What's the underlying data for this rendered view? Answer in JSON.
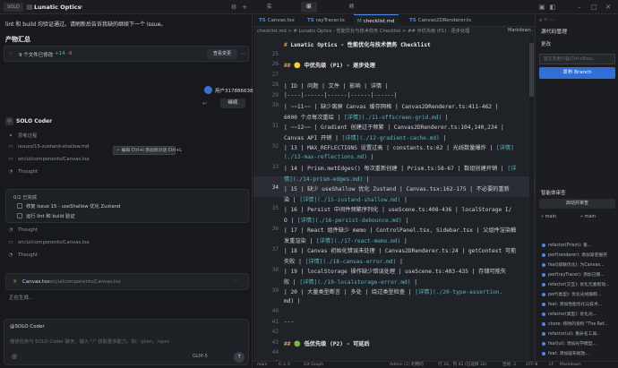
{
  "topbar": {
    "logo": "SOLO",
    "title": "Lunatic Optics",
    "tabs": [
      "实时跟踪",
      "编辑器",
      "终端"
    ],
    "active_tab": "编辑器"
  },
  "chat": {
    "message": "lint 和 build 均验证通过。请刷新后告诉我缺的继续下一个 Issue。",
    "products_heading": "产物汇总",
    "files_label": "9 个文件已修改",
    "files_added": "+14",
    "files_removed": "-9",
    "view_changes": "查看变更",
    "user_id": "用户3178866385",
    "continue_label": "继续",
    "agent_name": "SOLO Coder",
    "steps": [
      "思考过程",
      "issues/15-zustand-shallow.md",
      "src/ui/components/Canvas.tsx",
      "Thought"
    ],
    "todo_title": "0/2 已完成",
    "todos": [
      "修复 Issue 15 - useShallow 优化 Zustand",
      "运行 lint 和 build 验证"
    ],
    "steps2": [
      "Thought",
      "src/ui/components/Canvas.tsx",
      "Thought"
    ],
    "edit_file": "Canvas.tsx",
    "edit_path": "src/ui/components/Canvas.tsx",
    "generating": "正在生成...",
    "input_tag": "@SOLO Coder",
    "input_placeholder": "描述任务与 SOLO Coder 聊天，输入 \"/\" 获取更多能力。如：/plan、/spec",
    "model": "GLM-5"
  },
  "editor": {
    "tabs": [
      {
        "prefix": "TS",
        "name": "Canvas.tsx"
      },
      {
        "prefix": "TS",
        "name": "rayTracer.ts"
      },
      {
        "prefix": "M",
        "name": "checklist.md",
        "active": true
      },
      {
        "prefix": "TS",
        "name": "Canvas2DRenderer.ts"
      }
    ],
    "breadcrumb": "checklist.md > # Lunatic Optics - 性能优化与技术债务 Checklist > ## 中优先级 (P1) - 逐步处理",
    "markdown_btn": "Markdown",
    "hover_tip": "✓ 编辑 Ctrl+I 添加到对话 Ctrl+L",
    "lines": [
      {
        "n": "",
        "t": "# Lunatic Optics - 性能优化与技术债务 Checklist",
        "h": true
      },
      {
        "n": "25",
        "t": ""
      },
      {
        "n": "26",
        "t": "## 🟡 中优先级 (P1) - 逐步处理",
        "h": true
      },
      {
        "n": "27",
        "t": ""
      },
      {
        "n": "28",
        "t": "| ID | 问题 | 文件 | 影响 | 详情 |"
      },
      {
        "n": "29",
        "t": "|----|------|------|------|------|"
      },
      {
        "n": "30",
        "t": "| ~~11~~ | 缺少离屏 Canvas 缓存网格 | Canvas2DRenderer.ts:411-462 |"
      },
      {
        "n": "",
        "t": "6000 个点每次重绘 | [详情](./11-offscreen-grid.md) |"
      },
      {
        "n": "31",
        "t": "| ~~12~~ | Gradient 创建过于频繁 | Canvas2DRenderer.ts:104,140,234 |"
      },
      {
        "n": "",
        "t": "Canvas API 开销 | [详情](./12-gradient-cache.md) |"
      },
      {
        "n": "32",
        "t": "| 13 | MAX_REFLECTIONS 设置过高 | constants.ts:62 | 光线数量爆炸 | [详情]"
      },
      {
        "n": "",
        "t": "(./13-max-reflections.md) |"
      },
      {
        "n": "33",
        "t": "| 14 | Prism.metEdges() 每次重新创建 | Prism.ts:58-67 | 数组创建开销 | [详"
      },
      {
        "n": "",
        "t": "情](./14-prism-edges.md) |"
      },
      {
        "n": "34",
        "t": "| 15 | 缺少 useShallow 优化 Zustand | Canvas.tsx:162-175 | 不必要的重新"
      },
      {
        "n": "",
        "t": "染 | [详情](./15-zustand-shallow.md) |"
      },
      {
        "n": "35",
        "t": "| 16 | Persist 中间件频繁序列化 | useScene.ts:408-436 | localStorage I/"
      },
      {
        "n": "",
        "t": "O | [详情](./16-persist-debounce.md) |"
      },
      {
        "n": "36",
        "t": "| 17 | React 组件缺少 memo | ControlPanel.tsx, Sidebar.tsx | 父组件渲染触"
      },
      {
        "n": "",
        "t": "发重渲染 | [详情](./17-react-memo.md) |"
      },
      {
        "n": "37",
        "t": "| 18 | Canvas 初始化错误未处理 | Canvas2DRenderer.ts:24 | getContext 可能"
      },
      {
        "n": "",
        "t": "失败 | [详情](./18-canvas-error.md) |"
      },
      {
        "n": "38",
        "t": "| 19 | localStorage 操作缺少错误处理 | useScene.ts:403-435 | 存储可能失"
      },
      {
        "n": "",
        "t": "败 | [详情](./19-localstorage-error.md) |"
      },
      {
        "n": "39",
        "t": "| 20 | 大量类型断言 | 多处 | 绕过类型检查 | [详情](./20-type-assertion."
      },
      {
        "n": "",
        "t": "md) |"
      },
      {
        "n": "40",
        "t": ""
      },
      {
        "n": "41",
        "t": "---"
      },
      {
        "n": "42",
        "t": ""
      },
      {
        "n": "43",
        "t": "## 🟢 低优先级 (P2) - 可延后",
        "h": true
      },
      {
        "n": "44",
        "t": ""
      },
      {
        "n": "45",
        "t": "| ID | 问题 | 文件 | 影响 | 详情 |"
      }
    ]
  },
  "sidebar": {
    "title": "源代码管理",
    "changes": "更改",
    "commit_placeholder": "提交变更内容(Ctrl+Ente...",
    "publish": "发布 Branch",
    "worktree": "智能体审查",
    "worktree_btn": "启动并审查",
    "branch_left": "main",
    "branch_right": "main",
    "commits": [
      "refactor(Prism): 重...",
      "perf(renderer): 添加渐变缓存",
      "feat(级联优化): 为Canvas...",
      "perf(rayTracer): 添加已撑...",
      "refactor(交互): 优化元素拖动...",
      "perf(类型): 优化光线跟踪...",
      "feat: 添加性能优化与技术...",
      "refactor(类型): 优化光...",
      "chore: 移除的资料 \"The Ref...",
      "refactor(ui): 重命名工具..",
      "feat(ui): 添加光学模型...",
      "feat: 添加画布缩放..."
    ]
  },
  "status": {
    "left": "main",
    "errors": "0 ⚠ 0",
    "graph": "Git Graph",
    "user": "Admin (1) 利用的",
    "pos": "行 34，列 42 (已选择 32)",
    "spaces": "空格: 2",
    "encoding": "UTF-8",
    "eol": "LF",
    "lang": "Markdown"
  }
}
